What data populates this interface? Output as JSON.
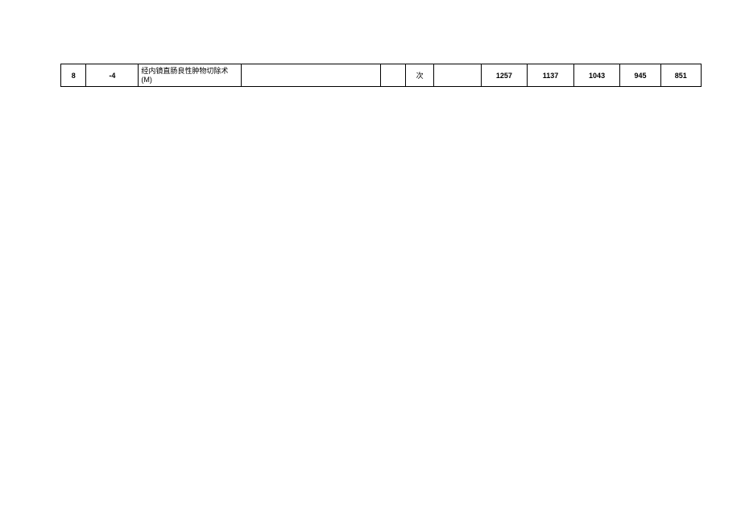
{
  "table": {
    "rows": [
      {
        "c1": "8",
        "c2": "-4",
        "c3": "经内镜直肠良性肿物切除术(M)",
        "c4": "",
        "c5": "",
        "c6": "次",
        "c7": "",
        "c8": "1257",
        "c9": "1137",
        "c10": "1043",
        "c11": "945",
        "c12": "851"
      }
    ]
  }
}
